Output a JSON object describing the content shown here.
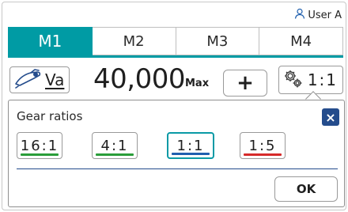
{
  "header": {
    "user_label": "User A",
    "user_icon": "person-icon"
  },
  "tabs": [
    {
      "label": "M1",
      "active": true
    },
    {
      "label": "M2",
      "active": false
    },
    {
      "label": "M3",
      "active": false
    },
    {
      "label": "M4",
      "active": false
    }
  ],
  "motor": {
    "mode_label": "Va",
    "mode_icon": "handpiece-icon",
    "speed_value": "40,000",
    "speed_limit_label": "Max",
    "increment_label": "+",
    "ratio_icon": "gear-icon",
    "ratio_value": "1:1"
  },
  "gear_popup": {
    "title": "Gear ratios",
    "close_label": "×",
    "options": [
      {
        "label": "16:1",
        "color": "#2a9d3a",
        "selected": false
      },
      {
        "label": "4:1",
        "color": "#2a9d3a",
        "selected": false
      },
      {
        "label": "1:1",
        "color": "#1f5fae",
        "selected": true
      },
      {
        "label": "1:5",
        "color": "#d62a2a",
        "selected": false
      }
    ],
    "ok_label": "OK"
  },
  "colors": {
    "accent": "#009ba4",
    "dark_blue": "#244c8c"
  }
}
